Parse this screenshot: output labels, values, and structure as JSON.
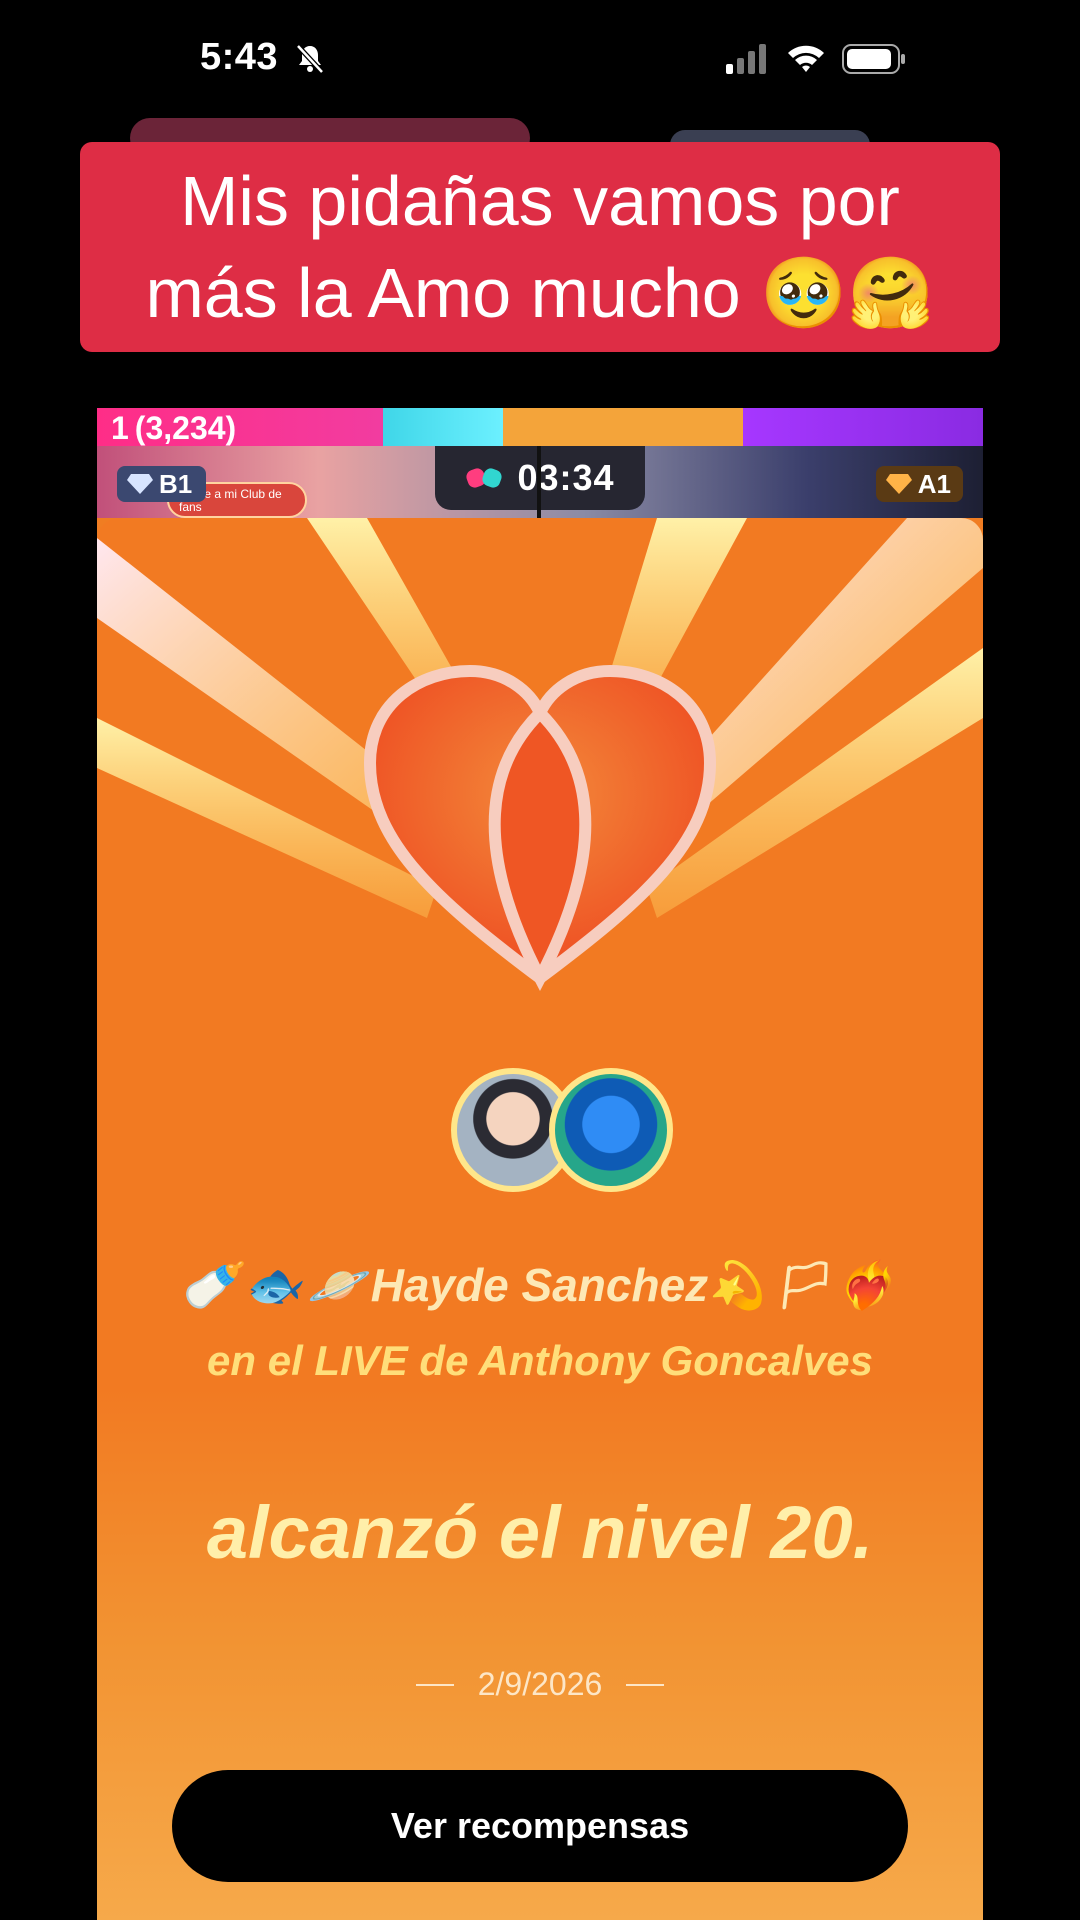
{
  "status_bar": {
    "time": "5:43"
  },
  "caption": {
    "text": "Mis pidañas vamos por más la Amo mucho 🥹🤗"
  },
  "battle": {
    "rank": "1",
    "score": "(3,234)",
    "timer": "03:34",
    "left_rank_badge": "B1",
    "right_rank_badge": "A1",
    "club_pill": "Únete a mi Club de fans"
  },
  "level_up": {
    "name_icons_left": "🍼🐟🪐",
    "user_name": "Hayde Sanchez",
    "name_icons_right": "💫🏳❤️‍🔥",
    "context": "en el LIVE de Anthony Goncalves",
    "level_text": "alcanzó el nivel 20.",
    "date": "2/9/2026",
    "button_label": "Ver recompensas"
  },
  "colors": {
    "caption_bg": "#de2d45",
    "panel_orange": "#f27a22",
    "button_bg": "#000000"
  }
}
